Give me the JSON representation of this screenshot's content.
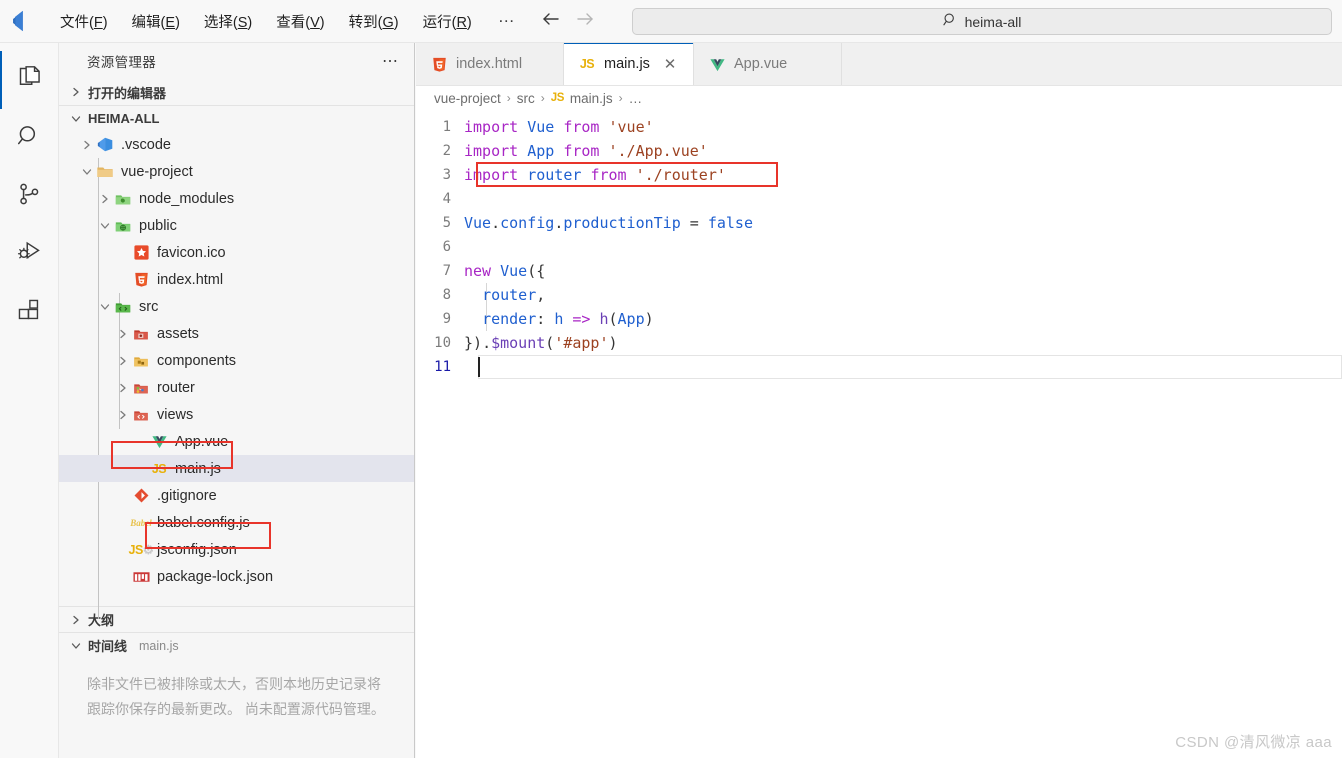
{
  "titlebar": {
    "logo_icon": "vscode-logo-icon",
    "menus": [
      {
        "name": "file",
        "label_cn": "文件",
        "key": "F"
      },
      {
        "name": "edit",
        "label_cn": "编辑",
        "key": "E"
      },
      {
        "name": "select",
        "label_cn": "选择",
        "key": "S"
      },
      {
        "name": "view",
        "label_cn": "查看",
        "key": "V"
      },
      {
        "name": "goto",
        "label_cn": "转到",
        "key": "G"
      },
      {
        "name": "run",
        "label_cn": "运行",
        "key": "R"
      }
    ],
    "more_label": "…",
    "back_icon": "arrow-left-icon",
    "forward_icon": "arrow-right-icon",
    "search": {
      "icon": "search-icon",
      "value": "heima-all",
      "placeholder": "heima-all"
    }
  },
  "activitybar": {
    "items": [
      {
        "name": "explorer",
        "icon": "files-icon",
        "active": true
      },
      {
        "name": "search",
        "icon": "search-icon",
        "active": false
      },
      {
        "name": "source-control",
        "icon": "git-branch-icon",
        "active": false
      },
      {
        "name": "run-debug",
        "icon": "debug-icon",
        "active": false
      },
      {
        "name": "extensions",
        "icon": "extensions-icon",
        "active": false
      }
    ]
  },
  "sidebar": {
    "title": "资源管理器",
    "actions_label": "⋯",
    "sections": [
      {
        "name": "open-editors",
        "label": "打开的编辑器",
        "expanded": false
      },
      {
        "name": "folder-root",
        "label": "HEIMA-ALL",
        "expanded": true
      },
      {
        "name": "outline",
        "label": "大纲",
        "expanded": false
      },
      {
        "name": "timeline",
        "label": "时间线",
        "expanded": true,
        "sub": "main.js"
      }
    ],
    "tree": [
      {
        "label": ".vscode",
        "icon": "vscode-folder-icon",
        "depth": 1,
        "twisty": "right",
        "kind": "folder"
      },
      {
        "label": "vue-project",
        "icon": "folder-icon",
        "depth": 1,
        "twisty": "down",
        "kind": "folder"
      },
      {
        "label": "node_modules",
        "icon": "node-folder-icon",
        "depth": 2,
        "twisty": "right",
        "kind": "folder"
      },
      {
        "label": "public",
        "icon": "public-folder-icon",
        "depth": 2,
        "twisty": "down",
        "kind": "folder"
      },
      {
        "label": "favicon.ico",
        "icon": "favicon-icon",
        "depth": 3,
        "twisty": "none",
        "kind": "file"
      },
      {
        "label": "index.html",
        "icon": "html5-icon",
        "depth": 3,
        "twisty": "none",
        "kind": "file"
      },
      {
        "label": "src",
        "icon": "src-folder-icon",
        "depth": 2,
        "twisty": "down",
        "kind": "folder"
      },
      {
        "label": "assets",
        "icon": "assets-folder-icon",
        "depth": 3,
        "twisty": "right",
        "kind": "folder"
      },
      {
        "label": "components",
        "icon": "components-folder-icon",
        "depth": 3,
        "twisty": "right",
        "kind": "folder"
      },
      {
        "label": "router",
        "icon": "router-folder-icon",
        "depth": 3,
        "twisty": "right",
        "kind": "folder",
        "annotated": true
      },
      {
        "label": "views",
        "icon": "views-folder-icon",
        "depth": 3,
        "twisty": "right",
        "kind": "folder"
      },
      {
        "label": "App.vue",
        "icon": "vue-icon",
        "depth": 3,
        "twisty": "none",
        "kind": "file"
      },
      {
        "label": "main.js",
        "icon": "js-icon",
        "depth": 3,
        "twisty": "none",
        "kind": "file",
        "selected": true,
        "annotated": true
      },
      {
        "label": ".gitignore",
        "icon": "git-icon",
        "depth": 2,
        "twisty": "none",
        "kind": "file"
      },
      {
        "label": "babel.config.js",
        "icon": "babel-icon",
        "depth": 2,
        "twisty": "none",
        "kind": "file"
      },
      {
        "label": "jsconfig.json",
        "icon": "jsconfig-icon",
        "depth": 2,
        "twisty": "none",
        "kind": "file"
      },
      {
        "label": "package-lock.json",
        "icon": "npm-icon",
        "depth": 2,
        "twisty": "none",
        "kind": "file"
      }
    ],
    "timeline_description": "除非文件已被排除或太大，否则本地历史记录将跟踪你保存的最新更改。 尚未配置源代码管理。"
  },
  "editor": {
    "tabs": [
      {
        "name": "index.html",
        "label": "index.html",
        "icon": "html5-icon",
        "active": false,
        "closable": false
      },
      {
        "name": "main.js",
        "label": "main.js",
        "icon": "js-icon",
        "active": true,
        "closable": true,
        "close_label": "✕"
      },
      {
        "name": "App.vue",
        "label": "App.vue",
        "icon": "vue-icon",
        "active": false,
        "closable": false
      }
    ],
    "breadcrumb": {
      "items": [
        "vue-project",
        "src",
        "main.js",
        "…"
      ],
      "file_icon": "js-icon",
      "file_icon_label": "JS",
      "separator": "›"
    },
    "code": {
      "language": "javascript",
      "active_line": 11,
      "lines": [
        {
          "n": 1,
          "tokens": [
            {
              "t": "import",
              "c": "kw"
            },
            {
              "t": " ",
              "c": "plain"
            },
            {
              "t": "Vue",
              "c": "id"
            },
            {
              "t": " ",
              "c": "plain"
            },
            {
              "t": "from",
              "c": "kw"
            },
            {
              "t": " ",
              "c": "plain"
            },
            {
              "t": "'vue'",
              "c": "str"
            }
          ]
        },
        {
          "n": 2,
          "tokens": [
            {
              "t": "import",
              "c": "kw"
            },
            {
              "t": " ",
              "c": "plain"
            },
            {
              "t": "App",
              "c": "id"
            },
            {
              "t": " ",
              "c": "plain"
            },
            {
              "t": "from",
              "c": "kw"
            },
            {
              "t": " ",
              "c": "plain"
            },
            {
              "t": "'./App.vue'",
              "c": "str"
            }
          ]
        },
        {
          "n": 3,
          "annotated": true,
          "tokens": [
            {
              "t": "import",
              "c": "kw"
            },
            {
              "t": " ",
              "c": "plain"
            },
            {
              "t": "router",
              "c": "id"
            },
            {
              "t": " ",
              "c": "plain"
            },
            {
              "t": "from",
              "c": "kw"
            },
            {
              "t": " ",
              "c": "plain"
            },
            {
              "t": "'./router'",
              "c": "str"
            }
          ]
        },
        {
          "n": 4,
          "tokens": []
        },
        {
          "n": 5,
          "tokens": [
            {
              "t": "Vue",
              "c": "id"
            },
            {
              "t": ".",
              "c": "op"
            },
            {
              "t": "config",
              "c": "prop"
            },
            {
              "t": ".",
              "c": "op"
            },
            {
              "t": "productionTip",
              "c": "prop"
            },
            {
              "t": " = ",
              "c": "op"
            },
            {
              "t": "false",
              "c": "lit"
            }
          ]
        },
        {
          "n": 6,
          "tokens": []
        },
        {
          "n": 7,
          "tokens": [
            {
              "t": "new",
              "c": "kw"
            },
            {
              "t": " ",
              "c": "plain"
            },
            {
              "t": "Vue",
              "c": "id"
            },
            {
              "t": "({",
              "c": "op"
            }
          ]
        },
        {
          "n": 8,
          "indent": 1,
          "tokens": [
            {
              "t": "  ",
              "c": "plain"
            },
            {
              "t": "router",
              "c": "id"
            },
            {
              "t": ",",
              "c": "op"
            }
          ]
        },
        {
          "n": 9,
          "indent": 1,
          "tokens": [
            {
              "t": "  ",
              "c": "plain"
            },
            {
              "t": "render",
              "c": "id"
            },
            {
              "t": ": ",
              "c": "op"
            },
            {
              "t": "h",
              "c": "id"
            },
            {
              "t": " ",
              "c": "plain"
            },
            {
              "t": "=>",
              "c": "kw"
            },
            {
              "t": " ",
              "c": "plain"
            },
            {
              "t": "h",
              "c": "fn"
            },
            {
              "t": "(",
              "c": "op"
            },
            {
              "t": "App",
              "c": "id"
            },
            {
              "t": ")",
              "c": "op"
            }
          ]
        },
        {
          "n": 10,
          "tokens": [
            {
              "t": "})",
              "c": "op"
            },
            {
              "t": ".",
              "c": "op"
            },
            {
              "t": "$mount",
              "c": "fn"
            },
            {
              "t": "(",
              "c": "op"
            },
            {
              "t": "'#app'",
              "c": "str"
            },
            {
              "t": ")",
              "c": "op"
            }
          ]
        },
        {
          "n": 11,
          "tokens": []
        }
      ]
    }
  },
  "watermark": "CSDN @清风微凉 aaa",
  "colors": {
    "accent": "#005fb8",
    "annotation_red": "#e8342a",
    "sidebar_bg": "#f6f6f6",
    "selection_bg": "#e3e4ed",
    "keyword": "#a826c5",
    "identifier": "#1f5fcf",
    "string": "#9c4221"
  }
}
